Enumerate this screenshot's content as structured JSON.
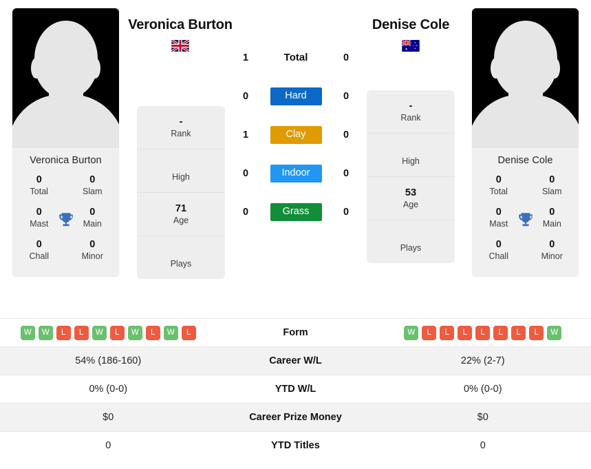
{
  "players": {
    "left": {
      "name": "Veronica Burton",
      "heading": "Veronica Burton",
      "flag": "united-kingdom-flag",
      "card_name": "Veronica Burton",
      "titles": [
        {
          "value": "0",
          "label": "Total"
        },
        {
          "value": "0",
          "label": "Slam"
        },
        {
          "value": "0",
          "label": "Mast"
        },
        {
          "value": "0",
          "label": "Main"
        },
        {
          "value": "0",
          "label": "Chall"
        },
        {
          "value": "0",
          "label": "Minor"
        }
      ],
      "detail": [
        {
          "value": "-",
          "label": "Rank"
        },
        {
          "value": "",
          "label": "High"
        },
        {
          "value": "71",
          "label": "Age"
        },
        {
          "value": "",
          "label": "Plays"
        }
      ],
      "form": [
        "W",
        "W",
        "L",
        "L",
        "W",
        "L",
        "W",
        "L",
        "W",
        "L"
      ],
      "career_wl": "54% (186-160)",
      "ytd_wl": "0% (0-0)",
      "career_prize_money": "$0",
      "ytd_titles": "0"
    },
    "right": {
      "name": "Denise Cole",
      "heading": "Denise Cole",
      "flag": "australia-flag",
      "card_name": "Denise Cole",
      "titles": [
        {
          "value": "0",
          "label": "Total"
        },
        {
          "value": "0",
          "label": "Slam"
        },
        {
          "value": "0",
          "label": "Mast"
        },
        {
          "value": "0",
          "label": "Main"
        },
        {
          "value": "0",
          "label": "Chall"
        },
        {
          "value": "0",
          "label": "Minor"
        }
      ],
      "detail": [
        {
          "value": "-",
          "label": "Rank"
        },
        {
          "value": "",
          "label": "High"
        },
        {
          "value": "53",
          "label": "Age"
        },
        {
          "value": "",
          "label": "Plays"
        }
      ],
      "form": [
        "W",
        "L",
        "L",
        "L",
        "L",
        "L",
        "L",
        "L",
        "W"
      ],
      "career_wl": "22% (2-7)",
      "ytd_wl": "0% (0-0)",
      "career_prize_money": "$0",
      "ytd_titles": "0"
    }
  },
  "head_to_head": [
    {
      "left": "1",
      "label": "Total",
      "right": "0",
      "badge": false,
      "color": ""
    },
    {
      "left": "0",
      "label": "Hard",
      "right": "0",
      "badge": true,
      "color": "#0b69c7"
    },
    {
      "left": "1",
      "label": "Clay",
      "right": "0",
      "badge": true,
      "color": "#e09b00"
    },
    {
      "left": "0",
      "label": "Indoor",
      "right": "0",
      "badge": true,
      "color": "#2196f3"
    },
    {
      "left": "0",
      "label": "Grass",
      "right": "0",
      "badge": true,
      "color": "#128d39"
    }
  ],
  "table": {
    "rows": [
      {
        "label": "Form",
        "type": "form"
      },
      {
        "label": "Career W/L",
        "left": "54% (186-160)",
        "right": "22% (2-7)"
      },
      {
        "label": "YTD W/L",
        "left": "0% (0-0)",
        "right": "0% (0-0)"
      },
      {
        "label": "Career Prize Money",
        "left": "$0",
        "right": "$0"
      },
      {
        "label": "YTD Titles",
        "left": "0",
        "right": "0"
      }
    ]
  },
  "colors": {
    "win": "#6ac06f",
    "loss": "#ef5b40",
    "trophy": "#3a72b8",
    "panel": "#eeeeee",
    "stripe": "#f2f2f2"
  },
  "icons": {
    "trophy": "trophy-icon"
  }
}
